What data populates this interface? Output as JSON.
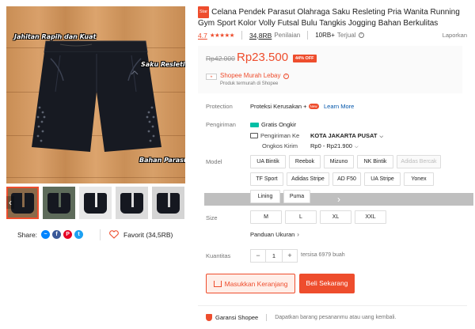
{
  "image": {
    "labels": [
      "Jahitan Rapih dan Kuat",
      "Saku Resleting",
      "Bahan Parasut"
    ]
  },
  "share": {
    "label": "Share:",
    "icons": [
      "messenger-icon",
      "facebook-icon",
      "pinterest-icon",
      "twitter-icon"
    ]
  },
  "favorite": {
    "label": "Favorit (34,5RB)"
  },
  "product": {
    "badge": "Star",
    "title": "Celana Pendek Parasut Olahraga Saku Resleting Pria Wanita Running Gym Sport Kolor Volly Futsal Bulu Tangkis Jogging Bahan Berkulitas",
    "rating": "4.7",
    "stars": "★★★★★",
    "rating_count": "34,8RB",
    "rating_label": "Penilaian",
    "sold_count": "10RB+",
    "sold_label": "Terjual",
    "report": "Laporkan"
  },
  "price": {
    "original": "Rp42.000",
    "current": "Rp23.500",
    "discount": "44% OFF",
    "promo_title": "Shopee Murah Lebay",
    "promo_sub": "Produk termurah di Shopee"
  },
  "protection": {
    "label": "Protection",
    "text": "Proteksi Kerusakan +",
    "badge": "New",
    "link": "Learn More"
  },
  "shipping": {
    "label": "Pengiriman",
    "free": "Gratis Ongkir",
    "to_label": "Pengiriman Ke",
    "to_value": "KOTA JAKARTA PUSAT",
    "cost_label": "Ongkos Kirim",
    "cost_value": "Rp0 - Rp21.900"
  },
  "model": {
    "label": "Model",
    "options": [
      {
        "text": "UA Bintik",
        "disabled": false
      },
      {
        "text": "Reebok",
        "disabled": false
      },
      {
        "text": "Mizuno",
        "disabled": false
      },
      {
        "text": "NK Bintik",
        "disabled": false
      },
      {
        "text": "Adidas Bercak",
        "disabled": true
      },
      {
        "text": "TF Sport",
        "disabled": false
      },
      {
        "text": "Adidas Stripe",
        "disabled": false
      },
      {
        "text": "AD F50",
        "disabled": false
      },
      {
        "text": "UA Stripe",
        "disabled": false
      },
      {
        "text": "Yonex",
        "disabled": false
      },
      {
        "text": "Lining",
        "disabled": false
      },
      {
        "text": "Puma",
        "disabled": false
      }
    ]
  },
  "size": {
    "label": "Size",
    "options": [
      "M",
      "L",
      "XL",
      "XXL"
    ],
    "guide": "Panduan Ukuran"
  },
  "quantity": {
    "label": "Kuantitas",
    "minus": "−",
    "value": "1",
    "plus": "+",
    "stock": "tersisa 6979 buah"
  },
  "actions": {
    "cart": "Masukkan Keranjang",
    "buy": "Beli Sekarang"
  },
  "guarantee": {
    "title": "Garansi Shopee",
    "desc": "Dapatkan barang pesananmu atau uang kembali."
  },
  "colors": {
    "accent": "#ee4d2d",
    "link": "#0055aa",
    "free_ship": "#00bfa5"
  }
}
